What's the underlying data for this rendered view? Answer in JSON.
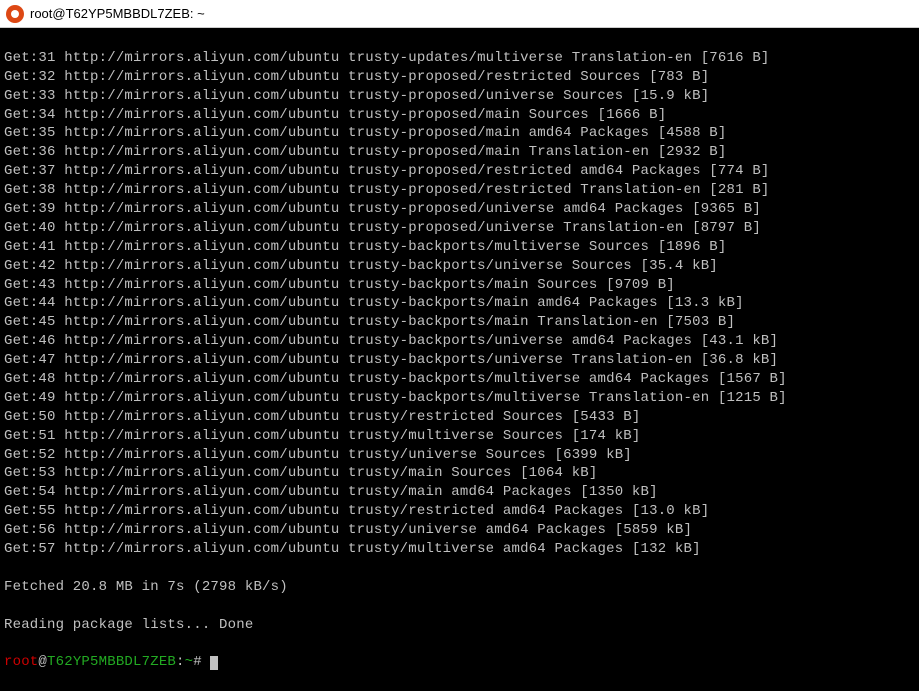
{
  "window": {
    "title": "root@T62YP5MBBDL7ZEB: ~"
  },
  "mirror": "http://mirrors.aliyun.com/ubuntu",
  "lines": [
    {
      "n": "31",
      "path": "trusty-updates/multiverse Translation-en",
      "size": "7616 B"
    },
    {
      "n": "32",
      "path": "trusty-proposed/restricted Sources",
      "size": "783 B"
    },
    {
      "n": "33",
      "path": "trusty-proposed/universe Sources",
      "size": "15.9 kB"
    },
    {
      "n": "34",
      "path": "trusty-proposed/main Sources",
      "size": "1666 B"
    },
    {
      "n": "35",
      "path": "trusty-proposed/main amd64 Packages",
      "size": "4588 B"
    },
    {
      "n": "36",
      "path": "trusty-proposed/main Translation-en",
      "size": "2932 B"
    },
    {
      "n": "37",
      "path": "trusty-proposed/restricted amd64 Packages",
      "size": "774 B"
    },
    {
      "n": "38",
      "path": "trusty-proposed/restricted Translation-en",
      "size": "281 B"
    },
    {
      "n": "39",
      "path": "trusty-proposed/universe amd64 Packages",
      "size": "9365 B"
    },
    {
      "n": "40",
      "path": "trusty-proposed/universe Translation-en",
      "size": "8797 B"
    },
    {
      "n": "41",
      "path": "trusty-backports/multiverse Sources",
      "size": "1896 B"
    },
    {
      "n": "42",
      "path": "trusty-backports/universe Sources",
      "size": "35.4 kB"
    },
    {
      "n": "43",
      "path": "trusty-backports/main Sources",
      "size": "9709 B"
    },
    {
      "n": "44",
      "path": "trusty-backports/main amd64 Packages",
      "size": "13.3 kB"
    },
    {
      "n": "45",
      "path": "trusty-backports/main Translation-en",
      "size": "7503 B"
    },
    {
      "n": "46",
      "path": "trusty-backports/universe amd64 Packages",
      "size": "43.1 kB"
    },
    {
      "n": "47",
      "path": "trusty-backports/universe Translation-en",
      "size": "36.8 kB"
    },
    {
      "n": "48",
      "path": "trusty-backports/multiverse amd64 Packages",
      "size": "1567 B"
    },
    {
      "n": "49",
      "path": "trusty-backports/multiverse Translation-en",
      "size": "1215 B"
    },
    {
      "n": "50",
      "path": "trusty/restricted Sources",
      "size": "5433 B"
    },
    {
      "n": "51",
      "path": "trusty/multiverse Sources",
      "size": "174 kB"
    },
    {
      "n": "52",
      "path": "trusty/universe Sources",
      "size": "6399 kB"
    },
    {
      "n": "53",
      "path": "trusty/main Sources",
      "size": "1064 kB"
    },
    {
      "n": "54",
      "path": "trusty/main amd64 Packages",
      "size": "1350 kB"
    },
    {
      "n": "55",
      "path": "trusty/restricted amd64 Packages",
      "size": "13.0 kB"
    },
    {
      "n": "56",
      "path": "trusty/universe amd64 Packages",
      "size": "5859 kB"
    },
    {
      "n": "57",
      "path": "trusty/multiverse amd64 Packages",
      "size": "132 kB"
    }
  ],
  "summary": {
    "fetched": "Fetched 20.8 MB in 7s (2798 kB/s)",
    "reading": "Reading package lists... Done"
  },
  "prompt": {
    "user": "root",
    "at": "@",
    "host": "T62YP5MBBDL7ZEB",
    "colon": ":",
    "path": "~",
    "hash": "# "
  }
}
